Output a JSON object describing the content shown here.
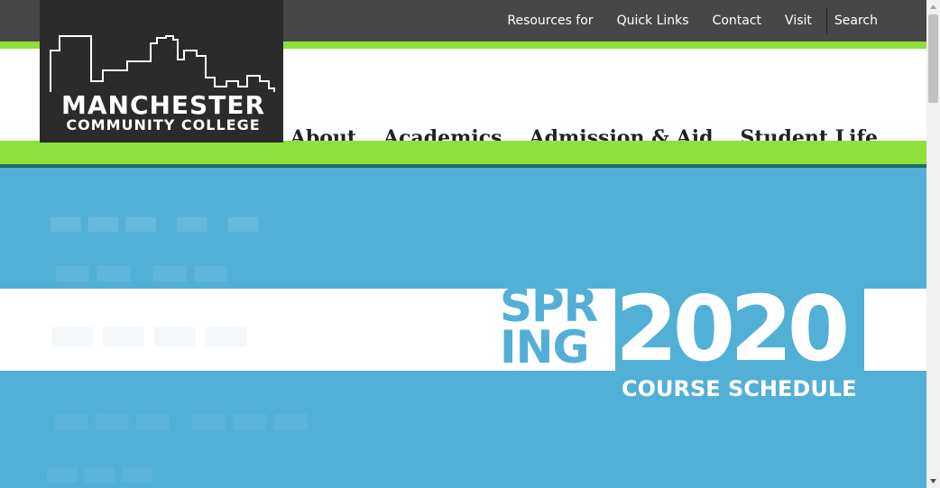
{
  "utility_nav": {
    "links": [
      "Resources for",
      "Quick Links",
      "Contact",
      "Visit"
    ],
    "search_label": "Search"
  },
  "logo": {
    "name": "MANCHESTER",
    "subtitle": "COMMUNITY COLLEGE"
  },
  "main_nav": {
    "items": [
      "About",
      "Academics",
      "Admission & Aid",
      "Student Life"
    ]
  },
  "hero": {
    "word_top": "SPR",
    "word_bottom": "ING",
    "year": "2020",
    "caption": "COURSE SCHEDULE"
  },
  "colors": {
    "utility_bar": "#474747",
    "accent_green": "#8ee03c",
    "hero_blue": "#52afd6",
    "logo_bg": "#2b2b2b"
  }
}
